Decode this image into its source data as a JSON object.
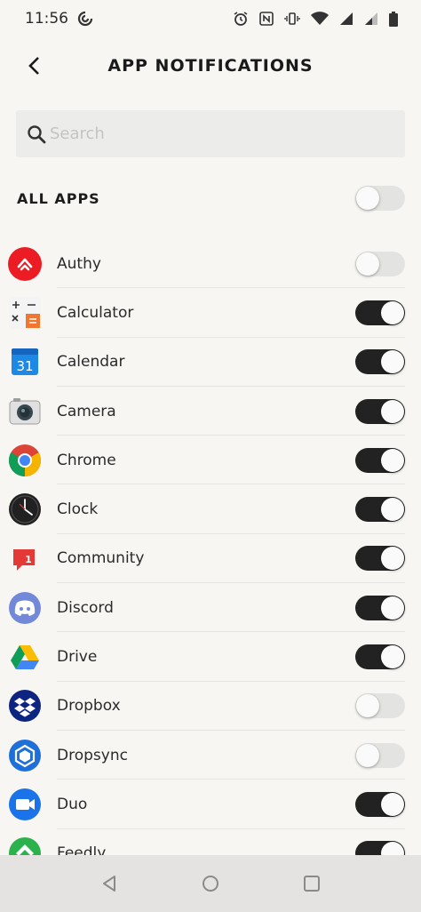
{
  "status": {
    "time": "11:56"
  },
  "header": {
    "title": "APP NOTIFICATIONS"
  },
  "search": {
    "placeholder": "Search",
    "value": ""
  },
  "all_apps": {
    "label": "ALL APPS",
    "enabled": false
  },
  "apps": [
    {
      "name": "Authy",
      "icon": "authy-icon",
      "enabled": false
    },
    {
      "name": "Calculator",
      "icon": "calculator-icon",
      "enabled": true
    },
    {
      "name": "Calendar",
      "icon": "calendar-icon",
      "enabled": true,
      "icon_text": "31"
    },
    {
      "name": "Camera",
      "icon": "camera-icon",
      "enabled": true
    },
    {
      "name": "Chrome",
      "icon": "chrome-icon",
      "enabled": true
    },
    {
      "name": "Clock",
      "icon": "clock-icon",
      "enabled": true
    },
    {
      "name": "Community",
      "icon": "community-icon",
      "enabled": true,
      "icon_text": "1"
    },
    {
      "name": "Discord",
      "icon": "discord-icon",
      "enabled": true
    },
    {
      "name": "Drive",
      "icon": "drive-icon",
      "enabled": true
    },
    {
      "name": "Dropbox",
      "icon": "dropbox-icon",
      "enabled": false
    },
    {
      "name": "Dropsync",
      "icon": "dropsync-icon",
      "enabled": false
    },
    {
      "name": "Duo",
      "icon": "duo-icon",
      "enabled": true
    },
    {
      "name": "Feedly",
      "icon": "feedly-icon",
      "enabled": true
    }
  ],
  "colors": {
    "background": "#f7f6f3",
    "toggle_on": "#222222",
    "toggle_off": "#e3e3e1",
    "nav_bar": "#e4e3e1"
  }
}
